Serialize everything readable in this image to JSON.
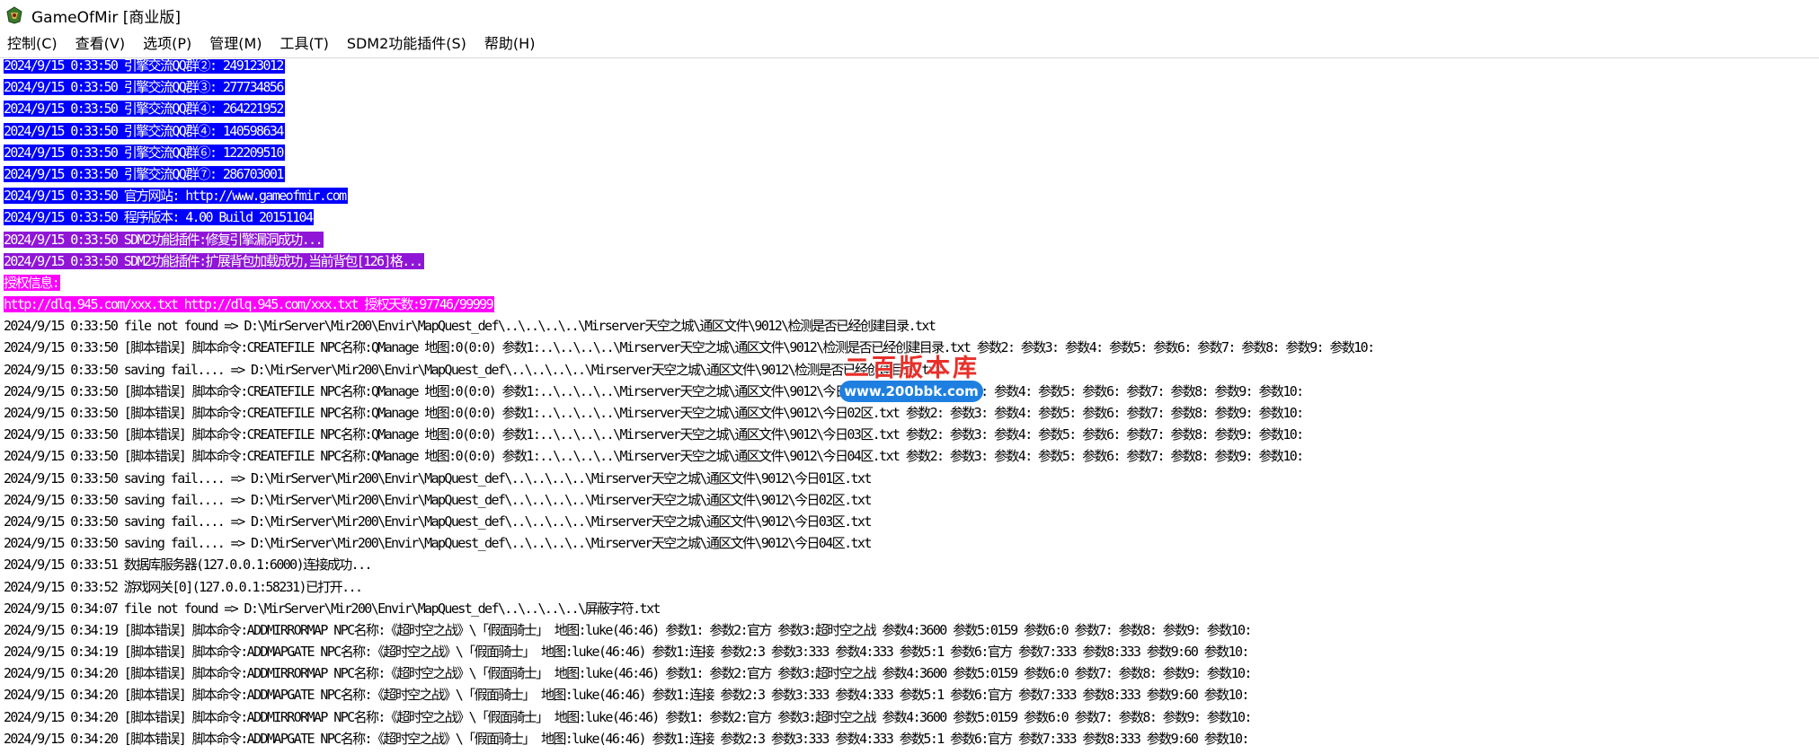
{
  "window": {
    "title": "GameOfMir [商业版]"
  },
  "menu": [
    {
      "label": "控制(C)"
    },
    {
      "label": "查看(V)"
    },
    {
      "label": "选项(P)"
    },
    {
      "label": "管理(M)"
    },
    {
      "label": "工具(T)"
    },
    {
      "label": "SDM2功能插件(S)"
    },
    {
      "label": "帮助(H)"
    }
  ],
  "colors": {
    "blue_highlight": "#0000ff",
    "purple_highlight": "#8f16d6",
    "magenta_highlight": "#ff00ff"
  },
  "log": [
    {
      "text": "2024/9/15 0:33:50 引擎交流QQ群②: 249123012",
      "bg": "#0000ff",
      "fg": "#ffffff"
    },
    {
      "text": "2024/9/15 0:33:50 引擎交流QQ群③: 277734856",
      "bg": "#0000ff",
      "fg": "#ffffff"
    },
    {
      "text": "2024/9/15 0:33:50 引擎交流QQ群④: 264221952",
      "bg": "#0000ff",
      "fg": "#ffffff"
    },
    {
      "text": "2024/9/15 0:33:50 引擎交流QQ群④: 140598634",
      "bg": "#0000ff",
      "fg": "#ffffff"
    },
    {
      "text": "2024/9/15 0:33:50 引擎交流QQ群⑥: 122209510",
      "bg": "#0000ff",
      "fg": "#ffffff"
    },
    {
      "text": "2024/9/15 0:33:50 引擎交流QQ群⑦: 286703001",
      "bg": "#0000ff",
      "fg": "#ffffff"
    },
    {
      "text": "2024/9/15 0:33:50 官方网站: http://www.gameofmir.com",
      "bg": "#0000ff",
      "fg": "#ffffff"
    },
    {
      "text": "2024/9/15 0:33:50 程序版本: 4.00 Build 20151104",
      "bg": "#0000ff",
      "fg": "#ffffff"
    },
    {
      "text": "2024/9/15 0:33:50 SDM2功能插件:修复引擎漏洞成功...",
      "bg": "#8f16d6",
      "fg": "#ffffff"
    },
    {
      "text": "2024/9/15 0:33:50 SDM2功能插件:扩展背包加载成功,当前背包[126]格...",
      "bg": "#8f16d6",
      "fg": "#ffffff"
    },
    {
      "text": "授权信息:",
      "bg": "#ff00ff",
      "fg": "#ffffff"
    },
    {
      "text": "http://dlq.945.com/xxx.txt http://dlq.945.com/xxx.txt 授权天数:97746/99999",
      "bg": "#ff00ff",
      "fg": "#ffffff"
    },
    {
      "text": "2024/9/15 0:33:50 file not found => D:\\MirServer\\Mir200\\Envir\\MapQuest_def\\..\\..\\..\\..\\Mirserver天空之城\\通区文件\\9012\\检测是否已经创建目录.txt",
      "bg": "",
      "fg": "#000000"
    },
    {
      "text": "2024/9/15 0:33:50 [脚本错误] 脚本命令:CREATEFILE NPC名称:QManage 地图:0(0:0) 参数1:..\\..\\..\\..\\Mirserver天空之城\\通区文件\\9012\\检测是否已经创建目录.txt 参数2: 参数3: 参数4: 参数5: 参数6: 参数7: 参数8: 参数9: 参数10:",
      "bg": "",
      "fg": "#000000"
    },
    {
      "text": "2024/9/15 0:33:50 saving fail.... => D:\\MirServer\\Mir200\\Envir\\MapQuest_def\\..\\..\\..\\..\\Mirserver天空之城\\通区文件\\9012\\检测是否已经创建目录.txt",
      "bg": "",
      "fg": "#000000"
    },
    {
      "text": "2024/9/15 0:33:50 [脚本错误] 脚本命令:CREATEFILE NPC名称:QManage 地图:0(0:0) 参数1:..\\..\\..\\..\\Mirserver天空之城\\通区文件\\9012\\今日01区.txt 参数2: 参数3: 参数4: 参数5: 参数6: 参数7: 参数8: 参数9: 参数10:",
      "bg": "",
      "fg": "#000000"
    },
    {
      "text": "2024/9/15 0:33:50 [脚本错误] 脚本命令:CREATEFILE NPC名称:QManage 地图:0(0:0) 参数1:..\\..\\..\\..\\Mirserver天空之城\\通区文件\\9012\\今日02区.txt 参数2: 参数3: 参数4: 参数5: 参数6: 参数7: 参数8: 参数9: 参数10:",
      "bg": "",
      "fg": "#000000"
    },
    {
      "text": "2024/9/15 0:33:50 [脚本错误] 脚本命令:CREATEFILE NPC名称:QManage 地图:0(0:0) 参数1:..\\..\\..\\..\\Mirserver天空之城\\通区文件\\9012\\今日03区.txt 参数2: 参数3: 参数4: 参数5: 参数6: 参数7: 参数8: 参数9: 参数10:",
      "bg": "",
      "fg": "#000000"
    },
    {
      "text": "2024/9/15 0:33:50 [脚本错误] 脚本命令:CREATEFILE NPC名称:QManage 地图:0(0:0) 参数1:..\\..\\..\\..\\Mirserver天空之城\\通区文件\\9012\\今日04区.txt 参数2: 参数3: 参数4: 参数5: 参数6: 参数7: 参数8: 参数9: 参数10:",
      "bg": "",
      "fg": "#000000"
    },
    {
      "text": "2024/9/15 0:33:50 saving fail.... => D:\\MirServer\\Mir200\\Envir\\MapQuest_def\\..\\..\\..\\..\\Mirserver天空之城\\通区文件\\9012\\今日01区.txt",
      "bg": "",
      "fg": "#000000"
    },
    {
      "text": "2024/9/15 0:33:50 saving fail.... => D:\\MirServer\\Mir200\\Envir\\MapQuest_def\\..\\..\\..\\..\\Mirserver天空之城\\通区文件\\9012\\今日02区.txt",
      "bg": "",
      "fg": "#000000"
    },
    {
      "text": "2024/9/15 0:33:50 saving fail.... => D:\\MirServer\\Mir200\\Envir\\MapQuest_def\\..\\..\\..\\..\\Mirserver天空之城\\通区文件\\9012\\今日03区.txt",
      "bg": "",
      "fg": "#000000"
    },
    {
      "text": "2024/9/15 0:33:50 saving fail.... => D:\\MirServer\\Mir200\\Envir\\MapQuest_def\\..\\..\\..\\..\\Mirserver天空之城\\通区文件\\9012\\今日04区.txt",
      "bg": "",
      "fg": "#000000"
    },
    {
      "text": "2024/9/15 0:33:51 数据库服务器(127.0.0.1:6000)连接成功...",
      "bg": "",
      "fg": "#000000"
    },
    {
      "text": "2024/9/15 0:33:52 游戏网关[0](127.0.0.1:58231)已打开...",
      "bg": "",
      "fg": "#000000"
    },
    {
      "text": "2024/9/15 0:34:07 file not found => D:\\MirServer\\Mir200\\Envir\\MapQuest_def\\..\\..\\..\\..\\屏蔽字符.txt",
      "bg": "",
      "fg": "#000000"
    },
    {
      "text": "2024/9/15 0:34:19 [脚本错误] 脚本命令:ADDMIRRORMAP NPC名称:《超时空之战》\\「假面骑士」 地图:luke(46:46) 参数1: 参数2:官方 参数3:超时空之战 参数4:3600 参数5:0159 参数6:0 参数7: 参数8: 参数9: 参数10:",
      "bg": "",
      "fg": "#000000"
    },
    {
      "text": "2024/9/15 0:34:19 [脚本错误] 脚本命令:ADDMAPGATE NPC名称:《超时空之战》\\「假面骑士」 地图:luke(46:46) 参数1:连接 参数2:3 参数3:333 参数4:333 参数5:1 参数6:官方 参数7:333 参数8:333 参数9:60 参数10:",
      "bg": "",
      "fg": "#000000"
    },
    {
      "text": "2024/9/15 0:34:20 [脚本错误] 脚本命令:ADDMIRRORMAP NPC名称:《超时空之战》\\「假面骑士」 地图:luke(46:46) 参数1: 参数2:官方 参数3:超时空之战 参数4:3600 参数5:0159 参数6:0 参数7: 参数8: 参数9: 参数10:",
      "bg": "",
      "fg": "#000000"
    },
    {
      "text": "2024/9/15 0:34:20 [脚本错误] 脚本命令:ADDMAPGATE NPC名称:《超时空之战》\\「假面骑士」 地图:luke(46:46) 参数1:连接 参数2:3 参数3:333 参数4:333 参数5:1 参数6:官方 参数7:333 参数8:333 参数9:60 参数10:",
      "bg": "",
      "fg": "#000000"
    },
    {
      "text": "2024/9/15 0:34:20 [脚本错误] 脚本命令:ADDMIRRORMAP NPC名称:《超时空之战》\\「假面骑士」 地图:luke(46:46) 参数1: 参数2:官方 参数3:超时空之战 参数4:3600 参数5:0159 参数6:0 参数7: 参数8: 参数9: 参数10:",
      "bg": "",
      "fg": "#000000"
    },
    {
      "text": "2024/9/15 0:34:20 [脚本错误] 脚本命令:ADDMAPGATE NPC名称:《超时空之战》\\「假面骑士」 地图:luke(46:46) 参数1:连接 参数2:3 参数3:333 参数4:333 参数5:1 参数6:官方 参数7:333 参数8:333 参数9:60 参数10:",
      "bg": "",
      "fg": "#000000"
    }
  ],
  "watermark": {
    "title": "二百版本库",
    "url": "www.200bbk.com"
  }
}
